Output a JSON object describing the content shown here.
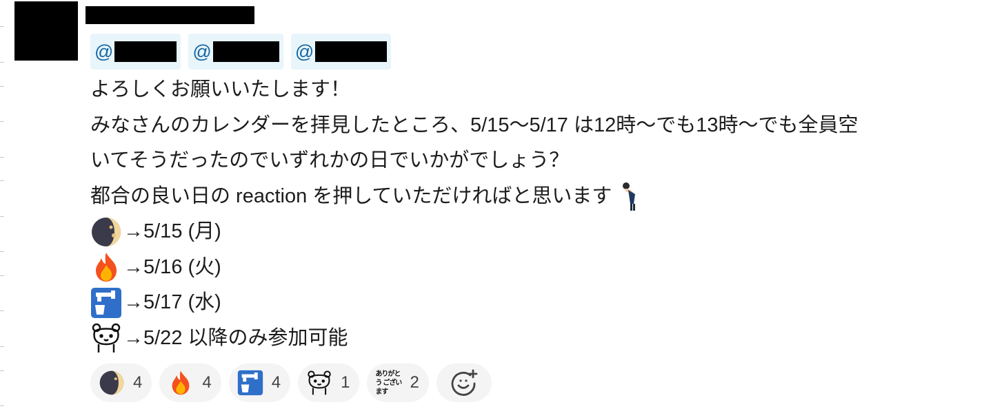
{
  "mentions": [
    {
      "at": "@"
    },
    {
      "at": "@"
    },
    {
      "at": "@"
    }
  ],
  "message": {
    "line1": "よろしくお願いいたします！",
    "line2": "みなさんのカレンダーを拝見したところ、5/15〜5/17 は12時〜でも13時〜でも全員空",
    "line3": "いてそうだったのでいずれかの日でいかがでしょう？",
    "line4": "都合の良い日の reaction を押していただければと思います",
    "options": [
      {
        "icon": "moon-icon",
        "text": "→5/15 (月)"
      },
      {
        "icon": "fire-icon",
        "text": "→5/16 (火)"
      },
      {
        "icon": "water-tap-icon",
        "text": "→5/17 (水)"
      },
      {
        "icon": "bear-icon",
        "text": "→5/22 以降のみ参加可能"
      }
    ]
  },
  "reactions": [
    {
      "icon": "moon-icon",
      "count": "4"
    },
    {
      "icon": "fire-icon",
      "count": "4"
    },
    {
      "icon": "water-tap-icon",
      "count": "4"
    },
    {
      "icon": "bear-icon",
      "count": "1"
    },
    {
      "icon": "arigatou-gozaimasu-icon",
      "label_line1": "ありがとう",
      "label_line2": "ございます",
      "count": "2"
    }
  ],
  "colors": {
    "mention_bg": "#e8f5fa",
    "mention_text": "#1264a3",
    "reaction_bg": "#f4f4f4"
  }
}
